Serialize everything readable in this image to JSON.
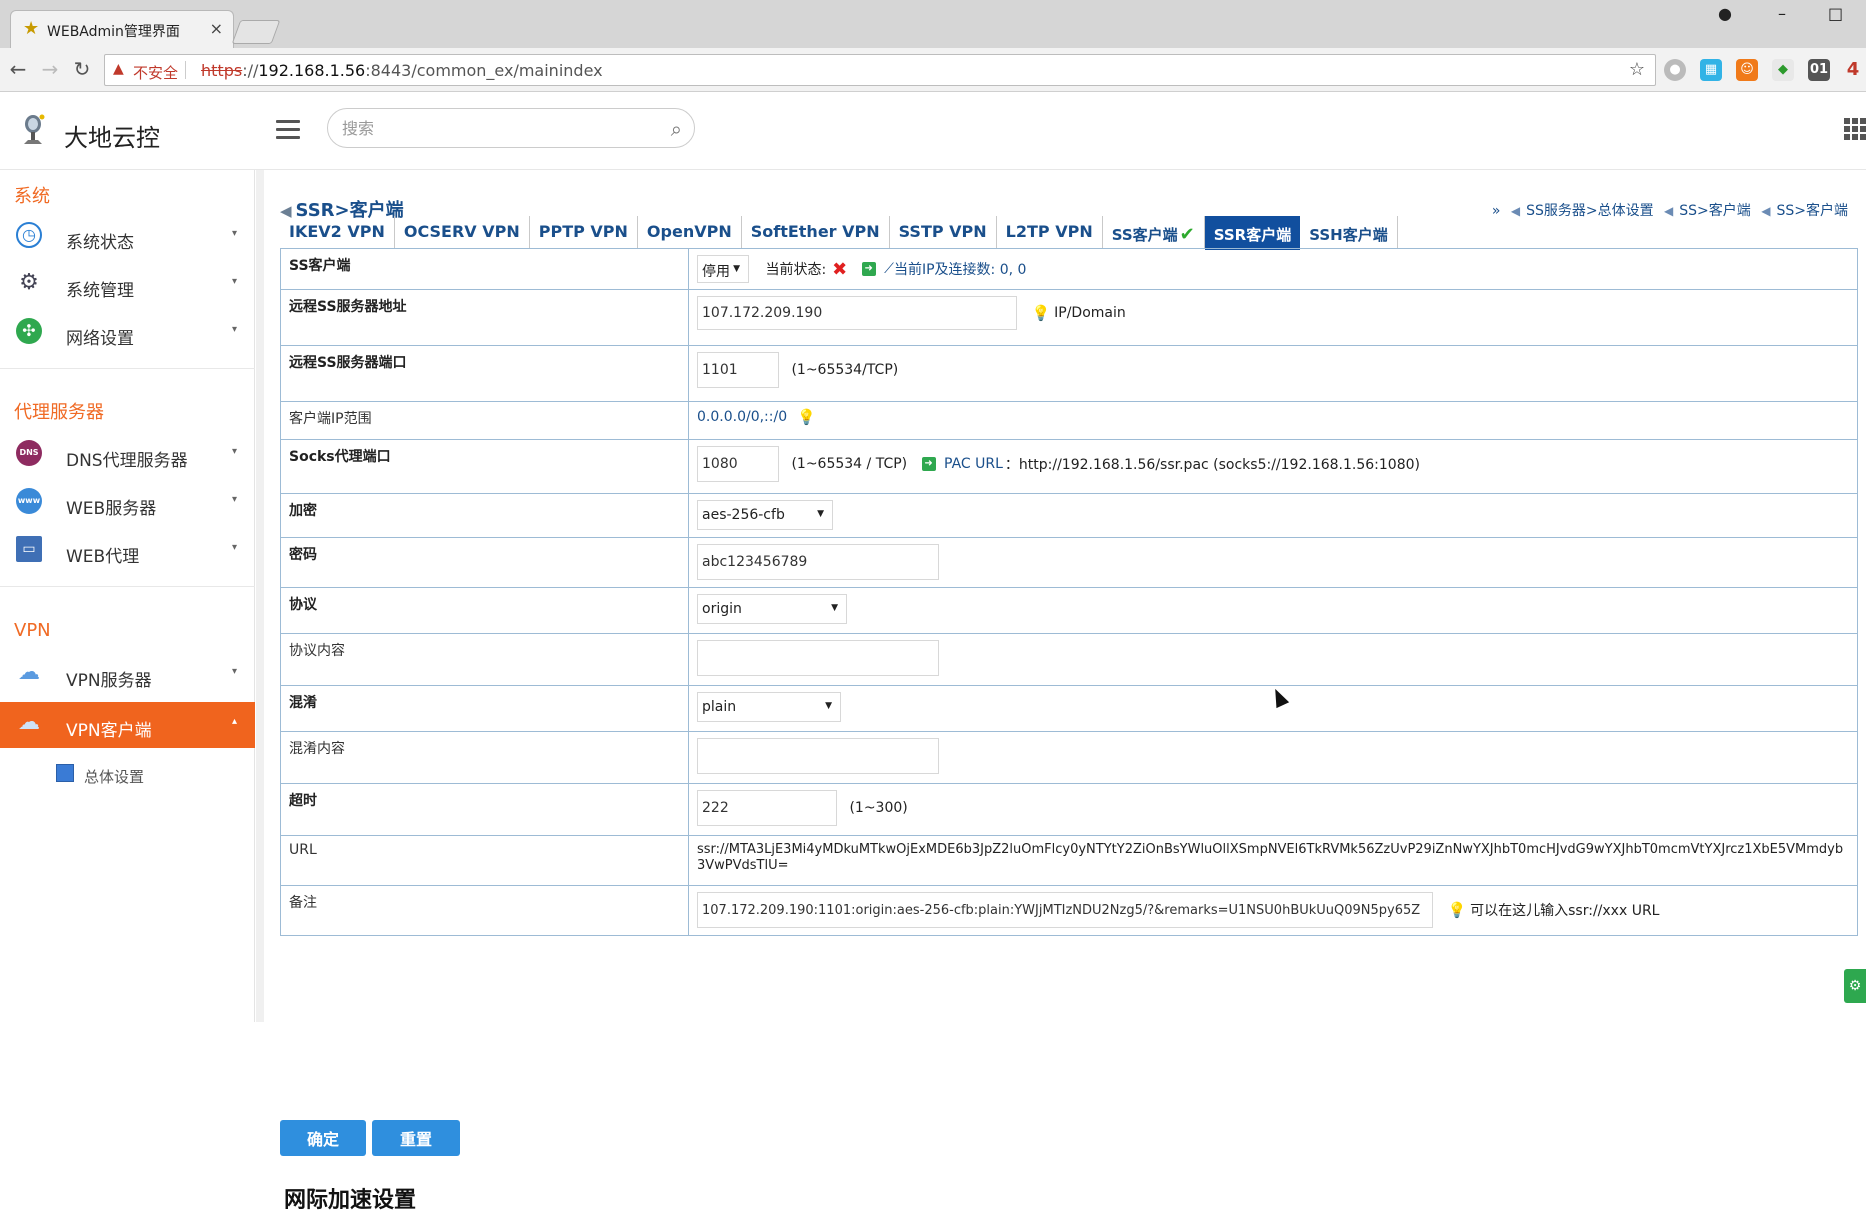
{
  "browser": {
    "tab_title": "WEBAdmin管理界面",
    "tab_close": "×",
    "win_user": "●",
    "win_min": "–",
    "win_max": "□",
    "back": "←",
    "forward": "→",
    "reload": "↻",
    "insecure_label": "不安全",
    "url_scheme": "https",
    "url_sep": "://",
    "url_host": "192.168.1.56",
    "url_rest": ":8443/common_ex/mainindex",
    "star": "☆",
    "extensions": [
      "●",
      "▦",
      "☺",
      "◆",
      "01",
      "4"
    ]
  },
  "app": {
    "logo_text": "大地云控",
    "search_placeholder": "搜索"
  },
  "sidebar": {
    "sections": [
      {
        "title": "系统",
        "items": [
          {
            "label": "系统状态",
            "icon": "dashboard-icon",
            "glyph": "◷"
          },
          {
            "label": "系统管理",
            "icon": "gears-icon",
            "glyph": "⚙"
          },
          {
            "label": "网络设置",
            "icon": "network-icon",
            "glyph": "✣"
          }
        ]
      },
      {
        "title": "代理服务器",
        "items": [
          {
            "label": "DNS代理服务器",
            "icon": "dns-icon",
            "glyph": "DNS"
          },
          {
            "label": "WEB服务器",
            "icon": "www-icon",
            "glyph": "www"
          },
          {
            "label": "WEB代理",
            "icon": "monitor-icon",
            "glyph": "▭"
          }
        ]
      },
      {
        "title": "VPN",
        "items": [
          {
            "label": "VPN服务器",
            "icon": "cloud-lightning-icon",
            "glyph": "☁"
          },
          {
            "label": "VPN客户端",
            "icon": "cloud-icon",
            "glyph": "☁"
          }
        ]
      }
    ],
    "sub_item": "总体设置",
    "caret_down": "▾",
    "caret_up": "▴"
  },
  "main": {
    "breadcrumb": "SSR>客户端",
    "quicklinks_prefix": "»",
    "quicklinks": [
      "SS服务器>总体设置",
      "SS>客户端",
      "SS>客户端"
    ],
    "tabs": [
      "IKEV2 VPN",
      "OCSERV VPN",
      "PPTP VPN",
      "OpenVPN",
      "SoftEther VPN",
      "SSTP VPN",
      "L2TP VPN",
      "SS客户端",
      "SSR客户端",
      "SSH客户端"
    ],
    "tab_check": "✔",
    "active_tab": "SSR客户端"
  },
  "form": {
    "ss_client_label": "SS客户端",
    "ss_client_value": "停用",
    "current_state_label": "当前状态:",
    "state_icon": "✖",
    "ip_conn_label": "当前IP及连接数: 0, 0",
    "remote_addr_label": "远程SS服务器地址",
    "remote_addr_value": "107.172.209.190",
    "remote_addr_hint": "IP/Domain",
    "remote_port_label": "远程SS服务器端口",
    "remote_port_value": "1101",
    "remote_port_hint": "(1~65534/TCP)",
    "client_ip_label": "客户端IP范围",
    "client_ip_value": "0.0.0.0/0,::/0",
    "socks_label": "Socks代理端口",
    "socks_value": "1080",
    "socks_hint": "(1~65534 / TCP)",
    "pac_label": "PAC URL",
    "pac_value": "：http://192.168.1.56/ssr.pac (socks5://192.168.1.56:1080)",
    "encrypt_label": "加密",
    "encrypt_value": "aes-256-cfb",
    "password_label": "密码",
    "password_value": "abc123456789",
    "protocol_label": "协议",
    "protocol_value": "origin",
    "protocol_param_label": "协议内容",
    "protocol_param_value": "",
    "obfs_label": "混淆",
    "obfs_value": "plain",
    "obfs_param_label": "混淆内容",
    "obfs_param_value": "",
    "timeout_label": "超时",
    "timeout_value": "222",
    "timeout_hint": "(1~300)",
    "url_label": "URL",
    "url_value": "ssr://MTA3LjE3Mi4yMDkuMTkwOjExMDE6b3JpZ2luOmFlcy0yNTYtY2ZiOnBsYWluOllXSmpNVEl6TkRVMk56ZzUvP29iZnNwYXJhbT0mcHJvdG9wYXJhbT0mcmVtYXJrcz1XbE5VMmdyb3VwPVdsTlU=",
    "remark_label": "备注",
    "remark_value": "107.172.209.190:1101:origin:aes-256-cfb:plain:YWJjMTIzNDU2Nzg5/?&remarks=U1NSU0hBUkUuQ09N5py65Z",
    "remark_hint": "可以在这儿输入ssr://xxx URL"
  },
  "buttons": {
    "ok": "确定",
    "reset": "重置"
  },
  "next_section_partial": "网际加速设置"
}
